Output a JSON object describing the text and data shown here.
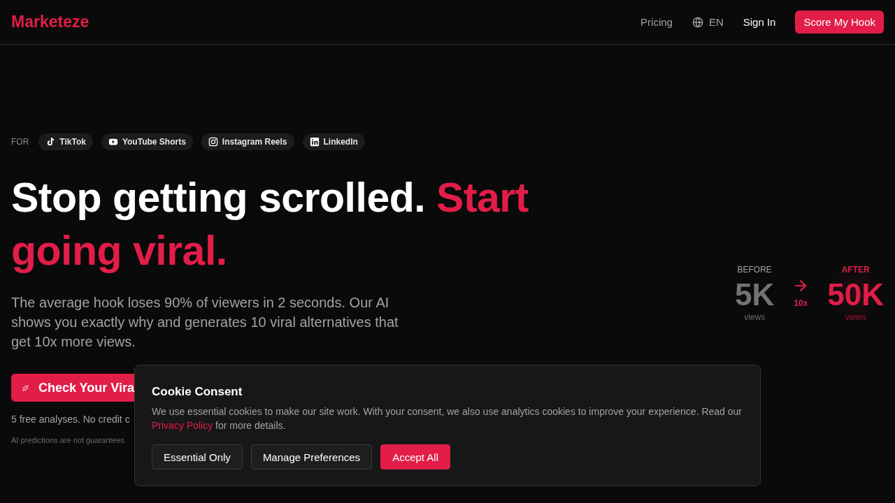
{
  "header": {
    "logo": "Marketeze",
    "nav": [
      {
        "kind": "link",
        "label": "Pricing"
      },
      {
        "kind": "language",
        "label": "EN"
      },
      {
        "kind": "signin",
        "label": "Sign In"
      },
      {
        "kind": "cta",
        "label": "Score My Hook"
      }
    ]
  },
  "hero": {
    "for_label": "FOR",
    "platforms": [
      {
        "kind": "tiktok",
        "label": "TikTok"
      },
      {
        "kind": "youtube",
        "label": "YouTube Shorts"
      },
      {
        "kind": "instagram",
        "label": "Instagram Reels"
      },
      {
        "kind": "linkedin",
        "label": "LinkedIn"
      }
    ],
    "headline": "Stop getting scrolled.",
    "headline_accent": "Start going viral.",
    "subtitle": "The average hook loses 90% of viewers in 2 seconds. Our AI shows you exactly why and generates 10 viral alternatives that get 10x more views.",
    "cta": "Check Your Vira",
    "note": "5 free analyses. No credit c",
    "disclaimer": "AI predictions are not guarantees"
  },
  "stats": {
    "before": {
      "label": "BEFORE",
      "value": "5K",
      "unit": "views"
    },
    "multiplier": "10x",
    "after": {
      "label": "AFTER",
      "value": "50K",
      "unit": "views"
    }
  },
  "cookie_banner": {
    "title": "Cookie Consent",
    "text_before": "We use essential cookies to make our site work. With your consent, we also use analytics cookies to improve your experience. Read our",
    "link": "Privacy Policy",
    "text_after": "for more details.",
    "buttons": [
      {
        "kind": "secondary",
        "label": "Essential Only"
      },
      {
        "kind": "secondary",
        "label": "Manage Preferences"
      },
      {
        "kind": "primary",
        "label": "Accept All"
      }
    ]
  }
}
